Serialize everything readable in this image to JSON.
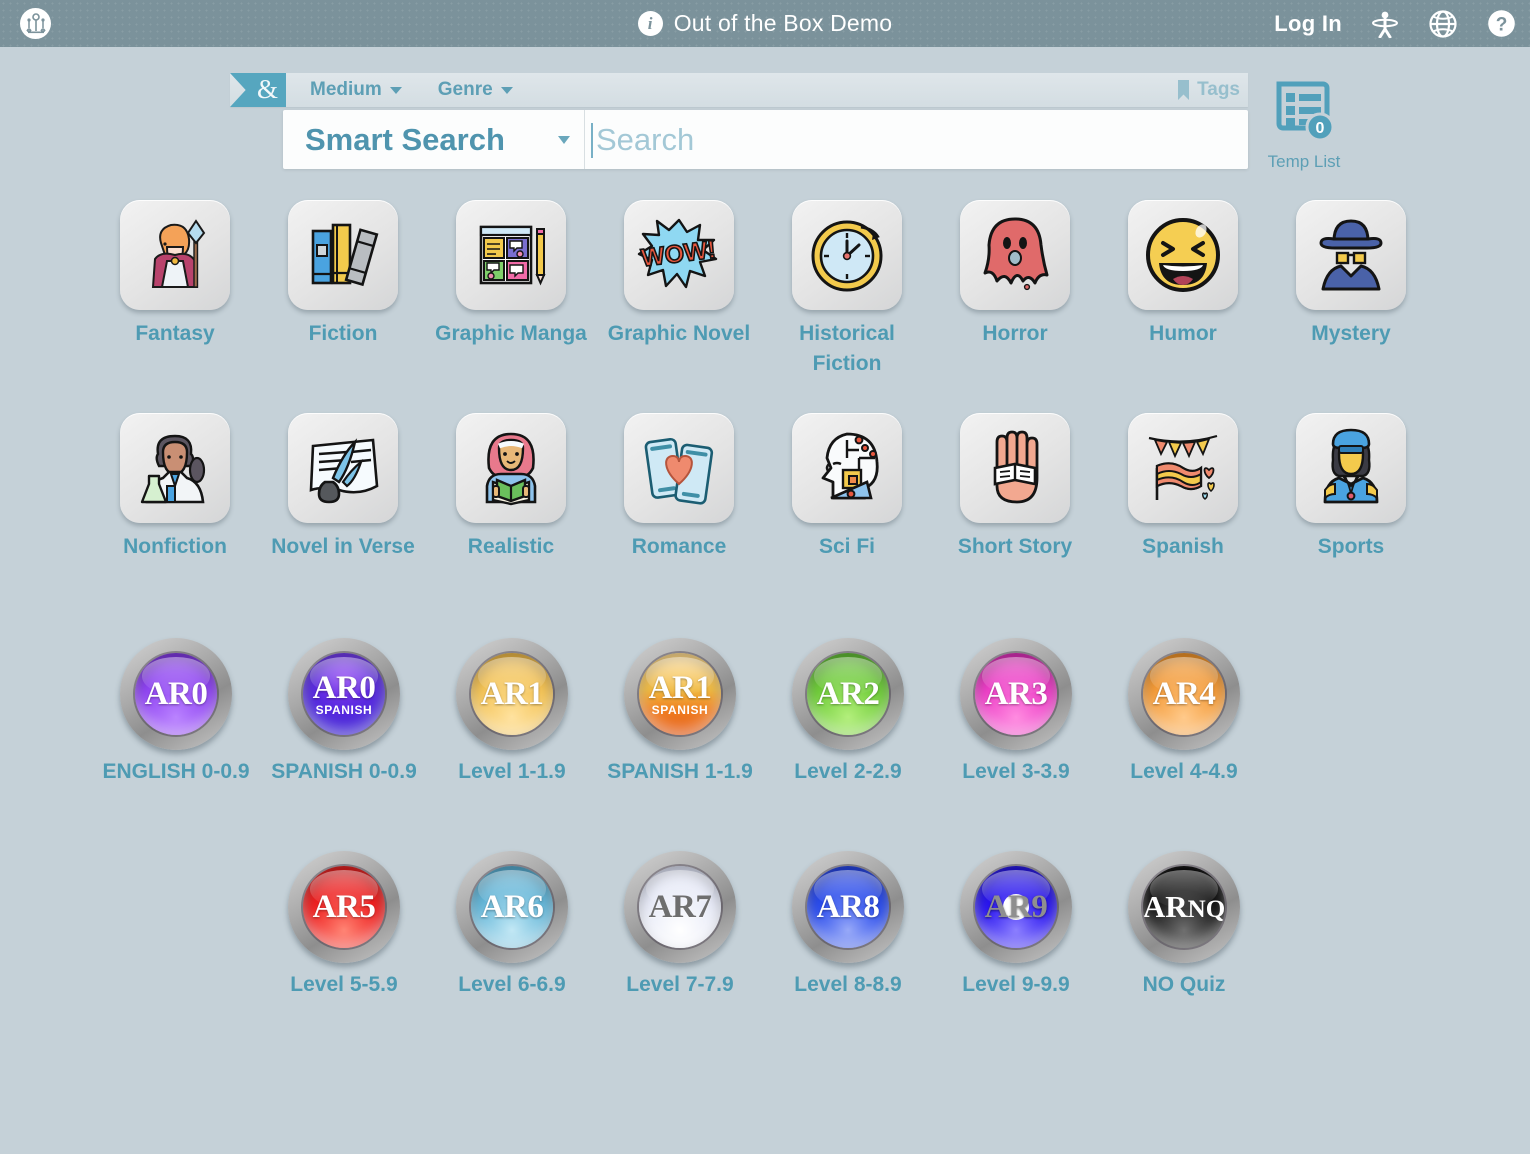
{
  "topbar": {
    "title": "Out of the Box Demo",
    "login_label": "Log In",
    "logo_name": "app-logo",
    "info_glyph": "i",
    "icons": [
      "accessibility-icon",
      "globe-icon",
      "help-icon"
    ]
  },
  "filterbar": {
    "ribbon_symbol": "&",
    "items": [
      {
        "label": "Medium"
      },
      {
        "label": "Genre"
      }
    ],
    "tags_label": "Tags"
  },
  "search": {
    "mode_label": "Smart Search",
    "placeholder": "Search",
    "value": ""
  },
  "templist": {
    "label": "Temp List",
    "count": "0"
  },
  "colors": {
    "accent": "#4e9bb3",
    "topbar": "#7b929b",
    "page_bg": "#c5d1d8",
    "ribbon": "#56a6bf"
  },
  "genres": [
    {
      "label": "Fantasy",
      "icon": "fantasy-mage-icon"
    },
    {
      "label": "Fiction",
      "icon": "books-icon"
    },
    {
      "label": "Graphic Manga",
      "icon": "manga-panels-icon"
    },
    {
      "label": "Graphic Novel",
      "icon": "wow-burst-icon"
    },
    {
      "label": "Historical Fiction",
      "icon": "clock-icon"
    },
    {
      "label": "Horror",
      "icon": "ghost-icon"
    },
    {
      "label": "Humor",
      "icon": "laughing-face-icon"
    },
    {
      "label": "Mystery",
      "icon": "detective-icon"
    },
    {
      "label": "Nonfiction",
      "icon": "scientist-icon"
    },
    {
      "label": "Novel in Verse",
      "icon": "quill-paper-icon"
    },
    {
      "label": "Realistic",
      "icon": "reader-hijab-icon"
    },
    {
      "label": "Romance",
      "icon": "phones-heart-icon"
    },
    {
      "label": "Sci Fi",
      "icon": "cyborg-head-icon"
    },
    {
      "label": "Short Story",
      "icon": "hand-book-icon"
    },
    {
      "label": "Spanish",
      "icon": "spanish-flag-icon"
    },
    {
      "label": "Sports",
      "icon": "athlete-icon"
    }
  ],
  "ar_levels": [
    {
      "badge": "AR0",
      "sub": "",
      "label": "ENGLISH 0-0.9",
      "color": "#8a3df0",
      "color2": "#b981ff"
    },
    {
      "badge": "AR0",
      "sub": "SPANISH",
      "label": "SPANISH 0-0.9",
      "color": "#3b1fd6",
      "color2": "#8a3df0"
    },
    {
      "badge": "AR1",
      "sub": "",
      "label": "Level 1-1.9",
      "color": "#f0b93f",
      "color2": "#ffd98a"
    },
    {
      "badge": "AR1",
      "sub": "SPANISH",
      "label": "SPANISH 1-1.9",
      "color": "#ef8a1e",
      "color2": "#ffcf7a"
    },
    {
      "badge": "AR2",
      "sub": "",
      "label": "Level 2-2.9",
      "color": "#5fc42f",
      "color2": "#a6ea6e"
    },
    {
      "badge": "AR3",
      "sub": "",
      "label": "Level 3-3.9",
      "color": "#e933c0",
      "color2": "#ff8ae0"
    },
    {
      "badge": "AR4",
      "sub": "",
      "label": "Level 4-4.9",
      "color": "#f0901e",
      "color2": "#ffc177"
    },
    {
      "badge": "AR5",
      "sub": "",
      "label": "Level 5-5.9",
      "color": "#e81d1d",
      "color2": "#ff7b6e"
    },
    {
      "badge": "AR6",
      "sub": "",
      "label": "Level 6-6.9",
      "color": "#4ba9cf",
      "color2": "#a8dcee"
    },
    {
      "badge": "AR7",
      "sub": "",
      "label": "Level 7-7.9",
      "color": "#dfe2f0",
      "color2": "#ffffff"
    },
    {
      "badge": "AR8",
      "sub": "",
      "label": "Level 8-8.9",
      "color": "#1b3fe8",
      "color2": "#7d93f5"
    },
    {
      "badge": "AR9",
      "sub": "",
      "label": "Level 9-9.9",
      "color": "#1c10f0",
      "color2": "#7b70ff"
    },
    {
      "badge": "ARNQ",
      "sub": "",
      "label": "NO Quiz",
      "color": "#000000",
      "color2": "#555555"
    }
  ]
}
